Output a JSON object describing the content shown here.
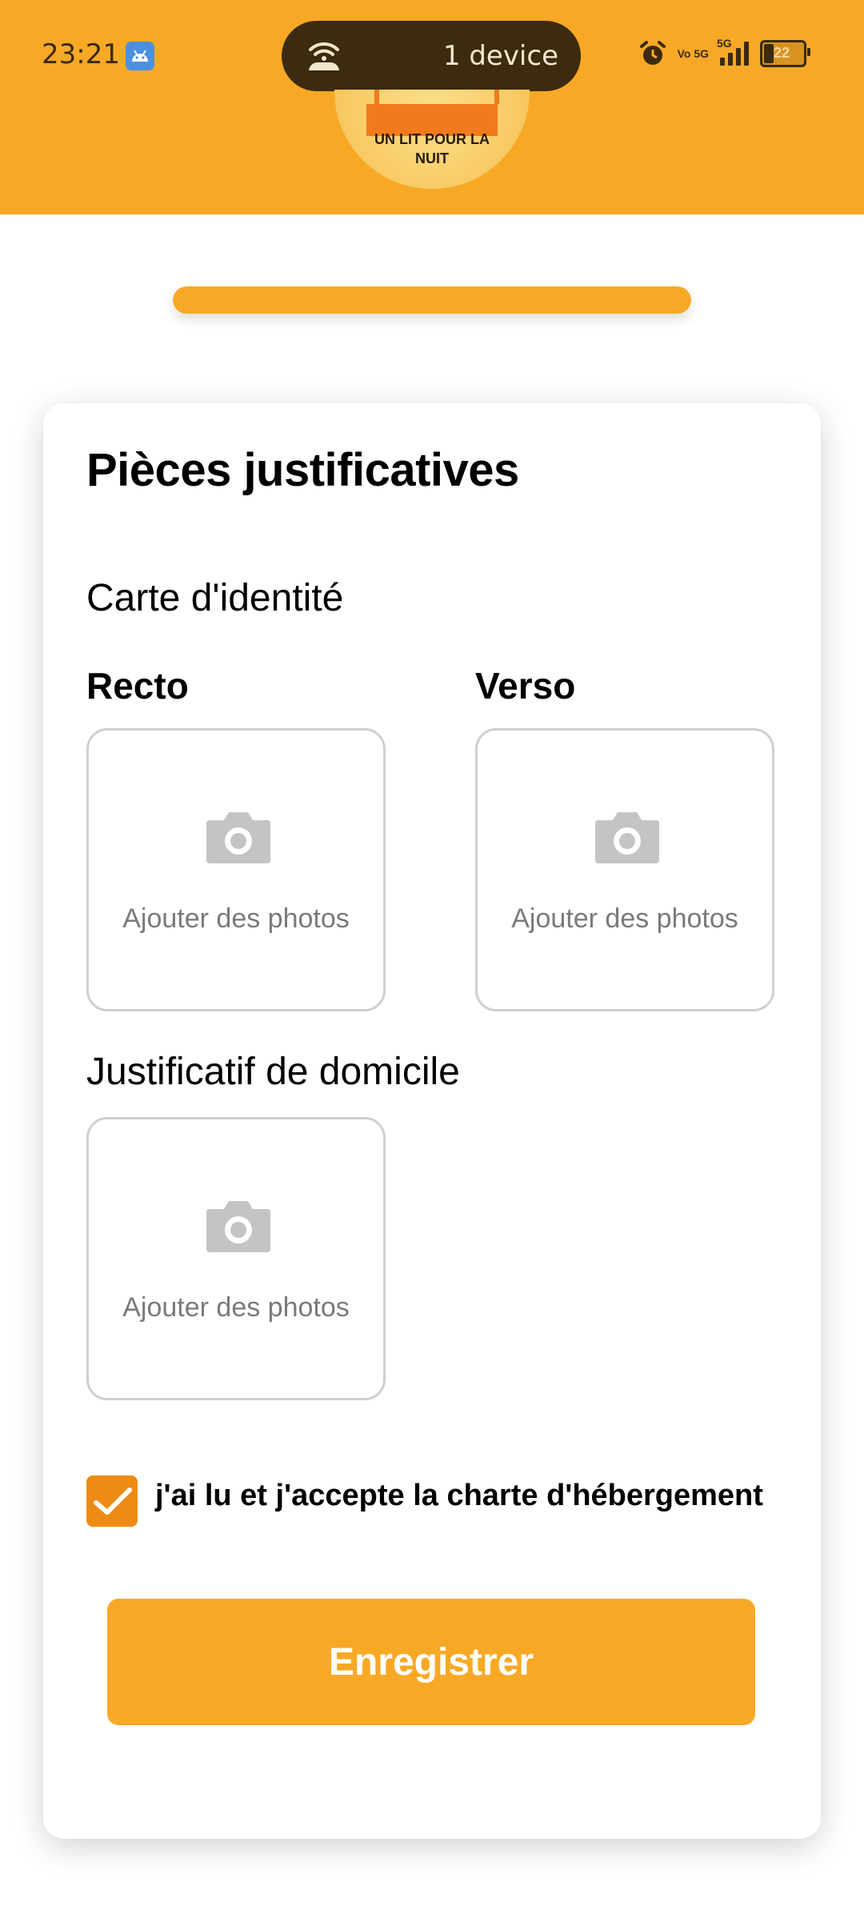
{
  "status_bar": {
    "time": "23:21",
    "hotspot_text": "1 device",
    "network": "5G",
    "volte": "Vo 5G",
    "battery": "22"
  },
  "logo": {
    "text_line1": "UN LIT POUR LA",
    "text_line2": "NUIT"
  },
  "progress": {
    "value": 1.0,
    "color": "#F7A926"
  },
  "form": {
    "title": "Pièces justificatives",
    "id_card_section": "Carte d'identité",
    "front_label": "Recto",
    "back_label": "Verso",
    "address_section": "Justificatif de domicile",
    "upload_placeholder": "Ajouter des photos",
    "upload_icon": "camera-icon",
    "consent_text": "j'ai lu et j'accepte la charte d'hébergement",
    "consent_checked": true,
    "submit_label": "Enregistrer"
  },
  "colors": {
    "accent": "#F7A926",
    "checkbox": "#EE8B14",
    "upload_border": "#cfcfcf",
    "placeholder_text": "#7a7a7a"
  }
}
